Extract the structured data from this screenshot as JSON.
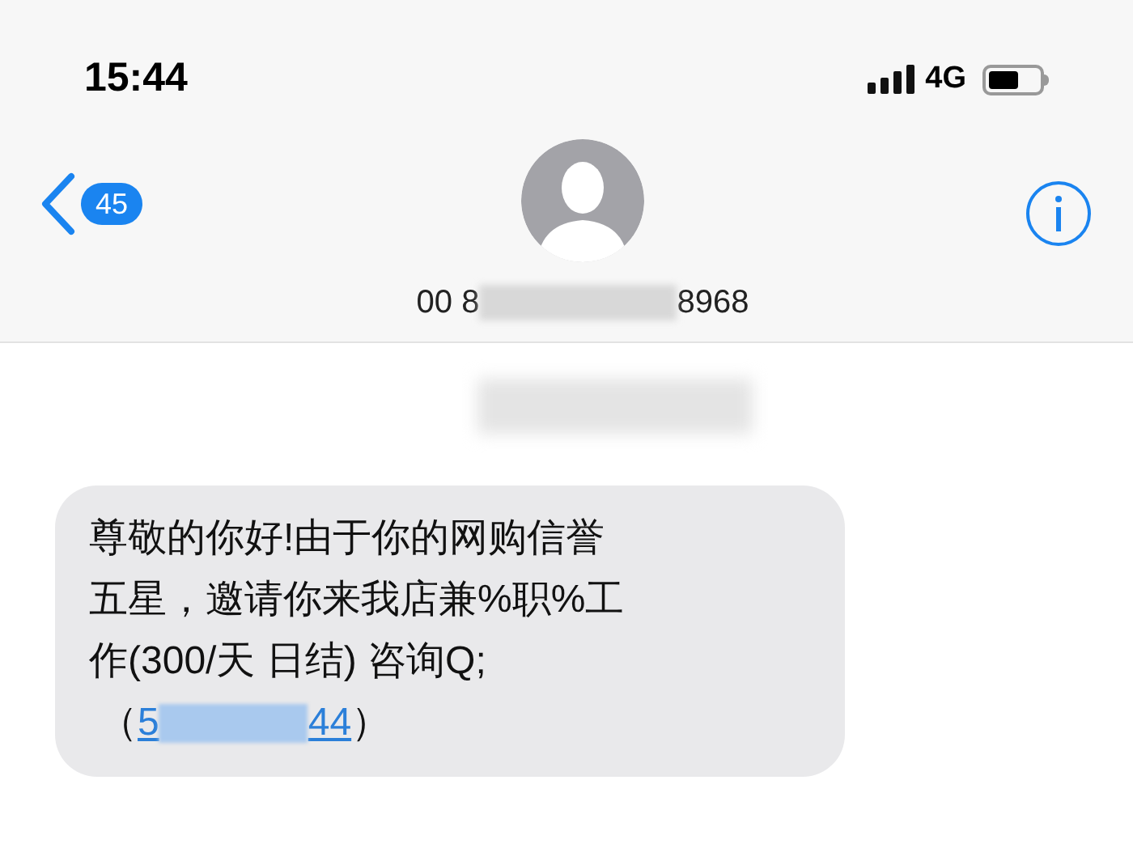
{
  "status_bar": {
    "time": "15:44",
    "network": "4G"
  },
  "nav": {
    "back_count": "45",
    "contact_number_start": "00 8",
    "contact_number_end": "8968"
  },
  "message": {
    "lines": [
      "尊敬的你好!由于你的网购信誉",
      "五星，邀请你来我店兼%职%工",
      "作(300/天 日结) 咨询Q;"
    ],
    "link_prefix": "（",
    "link_start": "5",
    "link_end": "44",
    "link_suffix": "）"
  }
}
